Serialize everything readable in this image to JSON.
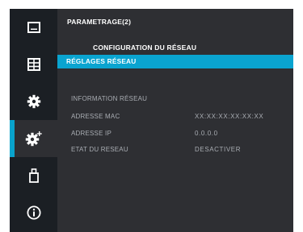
{
  "panel": {
    "title": "PARAMETRAGE(2)",
    "subtitle": "CONFIGURATION DU RÉSEAU",
    "selected_menu": "RÉGLAGES RÉSEAU",
    "section_title": "INFORMATION RÉSEAU",
    "rows": [
      {
        "label": "ADRESSE MAC",
        "value": "XX:XX:XX:XX:XX:XX"
      },
      {
        "label": "ADRESSE IP",
        "value": "0.0.0.0"
      },
      {
        "label": "ETAT DU RESEAU",
        "value": "DESACTIVER"
      }
    ]
  },
  "sidebar": {
    "items": [
      {
        "icon": "image-icon"
      },
      {
        "icon": "grid-icon"
      },
      {
        "icon": "gear-icon"
      },
      {
        "icon": "gear-plus-icon",
        "active": true
      },
      {
        "icon": "usb-icon"
      },
      {
        "icon": "info-icon"
      }
    ]
  },
  "colors": {
    "accent": "#0aa4d0",
    "panel_bg": "#2e2f33",
    "rail_bg": "#1b1f24",
    "text_dim": "#a9adb3"
  }
}
